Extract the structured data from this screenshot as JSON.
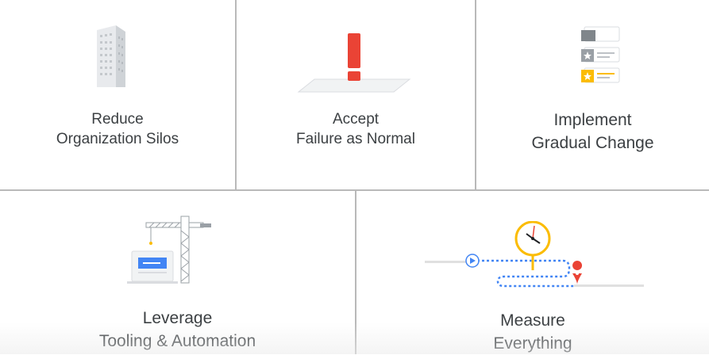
{
  "principles": [
    {
      "icon": "building-icon",
      "line1": "Reduce",
      "line2": "Organization Silos"
    },
    {
      "icon": "exclamation-icon",
      "line1": "Accept",
      "line2": "Failure as Normal"
    },
    {
      "icon": "cards-icon",
      "line1": "Implement",
      "line2": "Gradual Change"
    },
    {
      "icon": "crane-icon",
      "line1": "Leverage",
      "line2": "Tooling & Automation"
    },
    {
      "icon": "clock-route-icon",
      "line1": "Measure",
      "line2": "Everything"
    }
  ],
  "colors": {
    "divider": "#b9b9b9",
    "text": "#3c4043",
    "red": "#ea4335",
    "yellow": "#fbbc04",
    "blue": "#4285f4",
    "gray": "#9aa0a6"
  }
}
